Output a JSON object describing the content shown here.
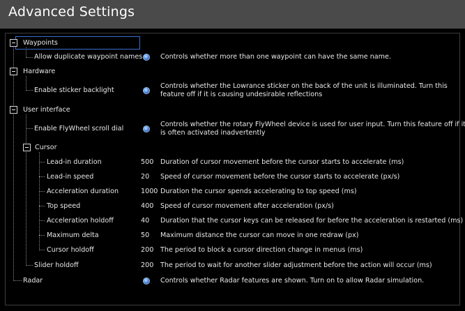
{
  "window": {
    "title": "Advanced Settings"
  },
  "tree": {
    "waypoints": {
      "label": "Waypoints",
      "allow_duplicate": {
        "label": "Allow duplicate waypoint names",
        "desc": "Controls whether more than one waypoint can have the same name."
      }
    },
    "hardware": {
      "label": "Hardware",
      "sticker_backlight": {
        "label": "Enable sticker backlight",
        "desc1": "Controls whether the Lowrance sticker on the back of the unit is illuminated. Turn this",
        "desc2": "feature off if it is causing undesirable reflections"
      }
    },
    "user_interface": {
      "label": "User interface",
      "flywheel": {
        "label": "Enable FlyWheel scroll dial",
        "desc1": "Controls whether the rotary FlyWheel device is used for user input. Turn this feature off if it",
        "desc2": "is often activated inadvertently"
      },
      "cursor": {
        "label": "Cursor",
        "items": [
          {
            "label": "Lead-in duration",
            "value": "500",
            "desc": "Duration of cursor movement before the cursor starts to accelerate (ms)"
          },
          {
            "label": "Lead-in speed",
            "value": "20",
            "desc": "Speed of cursor movement before the cursor starts to accelerate (px/s)"
          },
          {
            "label": "Acceleration duration",
            "value": "1000",
            "desc": "Duration the cursor spends accelerating to top speed (ms)"
          },
          {
            "label": "Top speed",
            "value": "400",
            "desc": "Speed of cursor movement after acceleration (px/s)"
          },
          {
            "label": "Acceleration holdoff",
            "value": "40",
            "desc": "Duration that the cursor keys can be released for before the acceleration is restarted (ms)"
          },
          {
            "label": "Maximum delta",
            "value": "50",
            "desc": "Maximum distance the cursor can move in one redraw (px)"
          },
          {
            "label": "Cursor holdoff",
            "value": "200",
            "desc": "The period to block a cursor direction change in menus (ms)"
          }
        ]
      },
      "slider_holdoff": {
        "label": "Slider holdoff",
        "value": "200",
        "desc": "The period to wait for another slider adjustment before the action will occur (ms)"
      }
    },
    "radar": {
      "label": "Radar",
      "desc": "Controls whether Radar features are shown. Turn on to allow Radar simulation."
    }
  }
}
